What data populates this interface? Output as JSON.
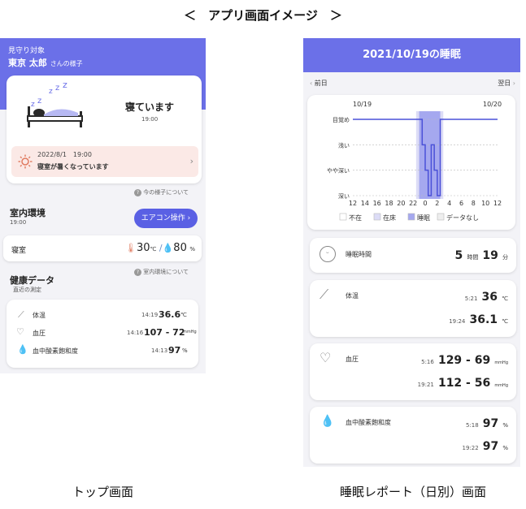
{
  "heading": "＜　アプリ画面イメージ　＞",
  "top_screen": {
    "caption": "トップ画面",
    "watch_target_label": "見守り対象",
    "user_name": "東京 太郎",
    "user_suffix": "さんの様子",
    "status": "寝ています",
    "status_time": "19:00",
    "alert_datetime": "2022/8/1　19:00",
    "alert_message": "寝室が暑くなっています",
    "about_now_link": "今の様子について",
    "env_title": "室内環境",
    "env_time": "19:00",
    "aircon_button": "エアコン操作",
    "room_label": "寝室",
    "temp_value": "30",
    "temp_unit": "℃",
    "humidity_value": "80",
    "humidity_unit": "%",
    "about_env_link": "室内環境について",
    "health_title": "健康データ",
    "health_sub": "直近の測定",
    "health_rows": [
      {
        "label": "体温",
        "time": "14:19",
        "value": "36.6",
        "unit": "℃"
      },
      {
        "label": "血圧",
        "time": "14:16",
        "value": "107 - 72",
        "unit": "mmHg"
      },
      {
        "label": "血中酸素飽和度",
        "time": "14:13",
        "value": "97",
        "unit": "%"
      }
    ]
  },
  "sleep_screen": {
    "caption": "睡眠レポート（日別）画面",
    "title": "2021/10/19の睡眠",
    "prev_label": "前日",
    "next_label": "翌日",
    "date_left": "10/19",
    "date_right": "10/20",
    "legend": [
      "不在",
      "在床",
      "睡眠",
      "データなし"
    ],
    "sleep_time_label": "睡眠時間",
    "sleep_hours": "5",
    "sleep_hours_unit": "時間",
    "sleep_minutes": "19",
    "sleep_minutes_unit": "分",
    "temp_label": "体温",
    "temp_rows": [
      {
        "time": "5:21",
        "value": "36",
        "unit": "℃"
      },
      {
        "time": "19:24",
        "value": "36.1",
        "unit": "℃"
      }
    ],
    "bp_label": "血圧",
    "bp_rows": [
      {
        "time": "5:16",
        "value": "129 - 69",
        "unit": "mmHg"
      },
      {
        "time": "19:21",
        "value": "112 - 56",
        "unit": "mmHg"
      }
    ],
    "spo2_label": "血中酸素飽和度",
    "spo2_rows": [
      {
        "time": "5:18",
        "value": "97",
        "unit": "%"
      },
      {
        "time": "19:22",
        "value": "97",
        "unit": "%"
      }
    ]
  },
  "chart_data": {
    "type": "line",
    "title": "",
    "categories": [
      "12",
      "14",
      "16",
      "18",
      "20",
      "22",
      "0",
      "2",
      "4",
      "6",
      "8",
      "10",
      "12"
    ],
    "levels": [
      "目覚め",
      "浅い",
      "やや深い",
      "深い"
    ],
    "in_bed_range": [
      "22:30",
      "03:00"
    ],
    "sleep_range": [
      "23:00",
      "02:30"
    ],
    "series": [
      {
        "values_by_hour": [
          {
            "x": "12",
            "level": "目覚め"
          },
          {
            "x": "23:00",
            "level": "目覚め"
          },
          {
            "x": "23:30",
            "level": "浅い"
          },
          {
            "x": "0:00",
            "level": "やや深い"
          },
          {
            "x": "0:30",
            "level": "深い"
          },
          {
            "x": "1:00",
            "level": "浅い"
          },
          {
            "x": "1:30",
            "level": "やや深い"
          },
          {
            "x": "2:00",
            "level": "深い"
          },
          {
            "x": "2:30",
            "level": "目覚め"
          },
          {
            "x": "12",
            "level": "目覚め"
          }
        ]
      }
    ]
  }
}
